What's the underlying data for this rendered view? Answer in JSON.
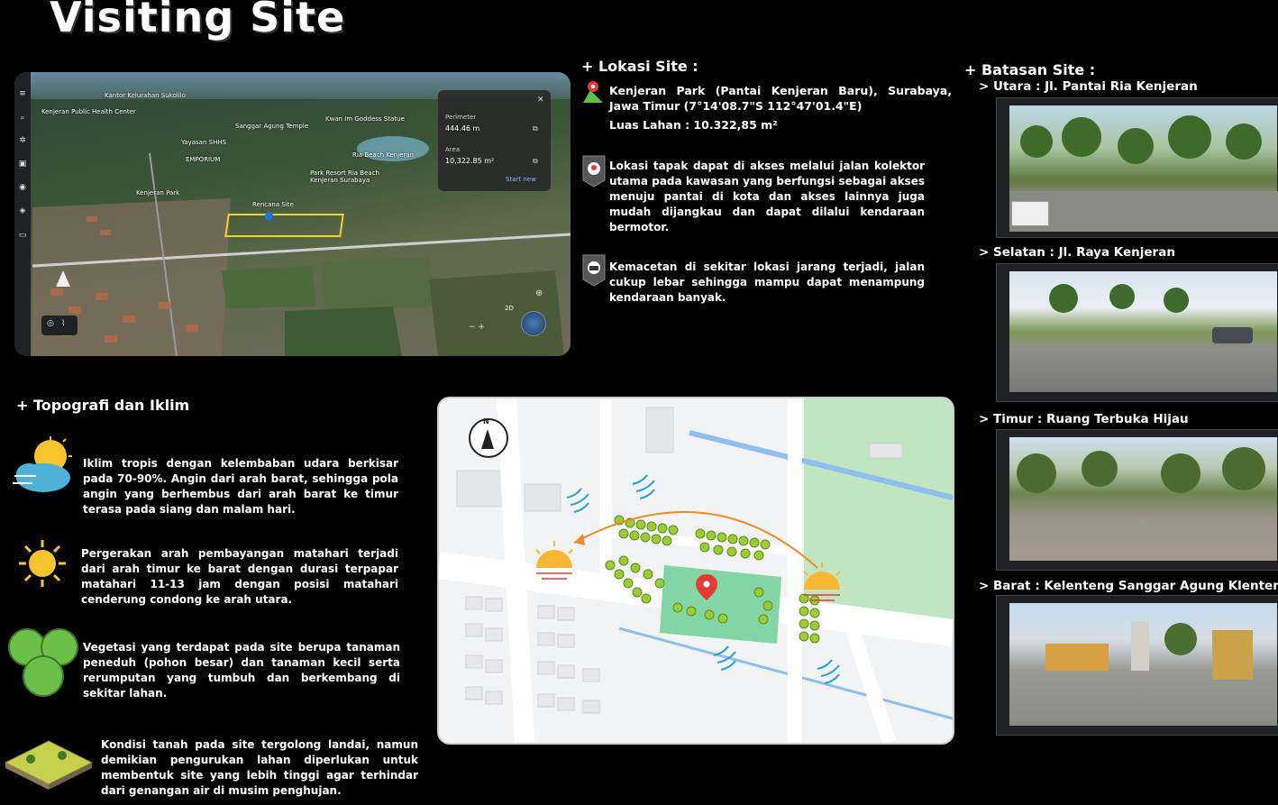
{
  "title": "Visiting Site",
  "lokasi": {
    "heading": "+ Lokasi Site :",
    "location_text": "Kenjeran Park (Pantai Kenjeran Baru), Surabaya, Jawa Timur (7°14'08.7\"S 112°47'01.4\"E)",
    "area_text": "Luas Lahan : 10.322,85 m²",
    "access_text": "Lokasi tapak dapat di akses melalui jalan kolektor utama pada kawasan yang berfungsi sebagai akses menuju pantai di kota dan akses lainnya juga mudah dijangkau dan dapat dilalui kendaraan bermotor.",
    "road_text": "Kemacetan di sekitar lokasi jarang terjadi, jalan cukup lebar sehingga mampu dapat menampung kendaraan banyak."
  },
  "batasan": {
    "heading": "+ Batasan Site :",
    "items": [
      {
        "label": "> Utara : Jl. Pantai Ria Kenjeran"
      },
      {
        "label": "> Selatan : Jl. Raya Kenjeran"
      },
      {
        "label": "> Timur : Ruang Terbuka Hijau"
      },
      {
        "label": "> Barat : Kelenteng Sanggar Agung Klenteng"
      }
    ]
  },
  "topografi": {
    "heading": "+ Topografi dan Iklim",
    "items": [
      {
        "icon": "weather-icon",
        "text": "Iklim tropis dengan kelembaban udara berkisar pada 70-90%. Angin dari arah barat, sehingga pola angin yang berhembus dari arah barat ke timur terasa pada siang dan malam hari."
      },
      {
        "icon": "sun-icon",
        "text": "Pergerakan arah pembayangan matahari terjadi dari arah timur ke barat dengan durasi terpapar matahari 11-13 jam dengan posisi matahari cenderung condong ke arah utara."
      },
      {
        "icon": "tree-icon",
        "text": "Vegetasi yang terdapat pada site berupa tanaman peneduh (pohon besar) dan tanaman kecil serta rerumputan yang tumbuh dan berkembang di sekitar lahan."
      },
      {
        "icon": "contour-icon",
        "text": "Kondisi tanah pada site tergolong landai, namun demikian pengurukan lahan diperlukan untuk membentuk site yang lebih tinggi agar terhindar dari genangan air di musim penghujan."
      }
    ]
  },
  "earth": {
    "perimeter_label": "Perimeter",
    "perimeter_value": "444.46 m",
    "area_label": "Area",
    "area_value": "10,322.85 m²",
    "start_new": "Start new",
    "places": [
      {
        "name": "Kantor Kelurahan Sukolilo"
      },
      {
        "name": "Kenjeran Public Health Center"
      },
      {
        "name": "Sanggar Agung Temple"
      },
      {
        "name": "Kwan Im Goddess Statue"
      },
      {
        "name": "Yayasan SHHS"
      },
      {
        "name": "EMPORIUM"
      },
      {
        "name": "Ria Beach Kenjeran"
      },
      {
        "name": "Park Resort Ria Beach Kenjeran Surabaya"
      },
      {
        "name": "Kenjeran Park"
      },
      {
        "name": "Rencana Site"
      }
    ],
    "view_2d": "2D"
  },
  "map": {
    "compass_label": "N"
  }
}
